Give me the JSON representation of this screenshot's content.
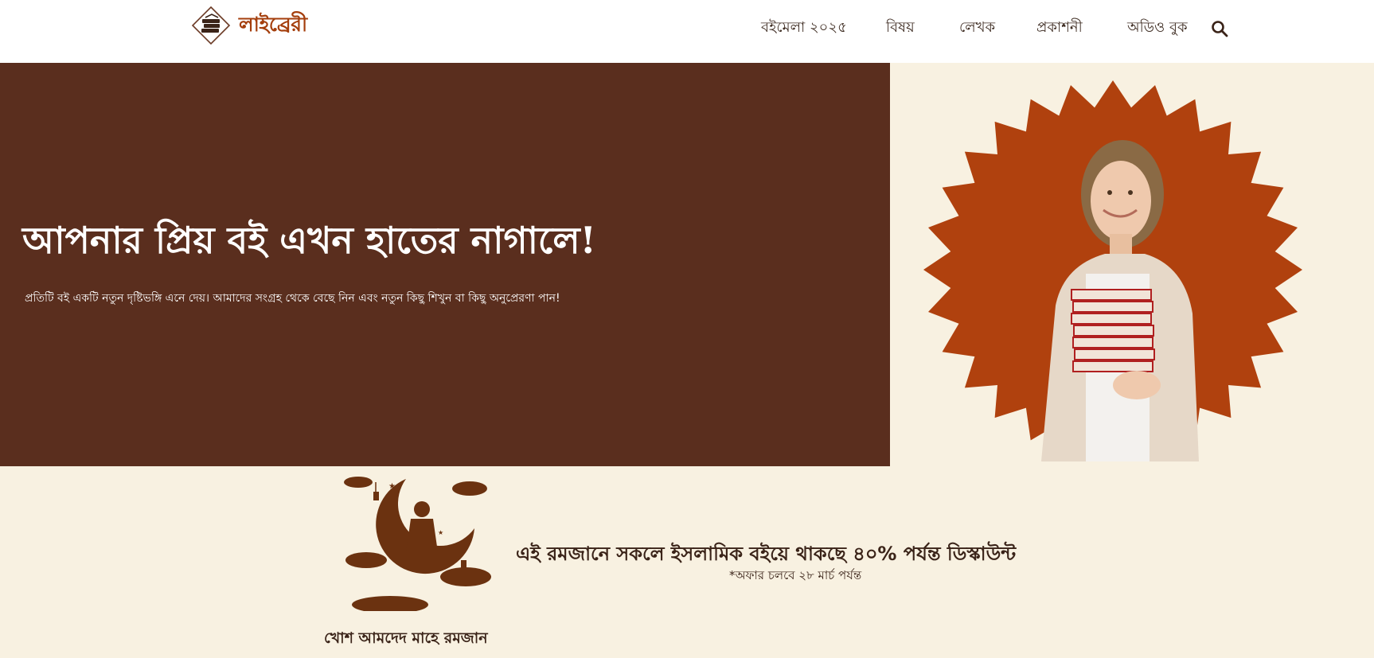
{
  "header": {
    "logo_text": "লাইব্রেরী",
    "nav": [
      {
        "label": "বইমেলা ২০২৫"
      },
      {
        "label": "বিষয়"
      },
      {
        "label": "লেখক"
      },
      {
        "label": "প্রকাশনী"
      },
      {
        "label": "অডিও বুক"
      }
    ],
    "search_icon": "search-icon"
  },
  "hero": {
    "title": "আপনার প্রিয় বই এখন হাতের নাগালে!",
    "subtitle": "প্রতিটি বই একটি নতুন দৃষ্টিভঙ্গি এনে দেয়। আমাদের সংগ্রহ থেকে বেছে নিন এবং নতুন কিছু শিখুন বা কিছু অনুপ্রেরণা পান!"
  },
  "ramadan": {
    "greeting": "খোশ আমদেদ মাহে রমজান",
    "promo": "এই রমজানে সকলে ইসলামিক বইয়ে থাকছে ৪০% পর্যন্ত ডিস্কাউন্ট",
    "note": "*অফার চলবে ২৮ মার্চ পর্যন্ত"
  },
  "colors": {
    "brand": "#a43e0c",
    "hero_bg": "#5a2e1e",
    "cream": "#f8f1e1",
    "starburst": "#b0410e",
    "ramadan_art": "#6b3210"
  }
}
